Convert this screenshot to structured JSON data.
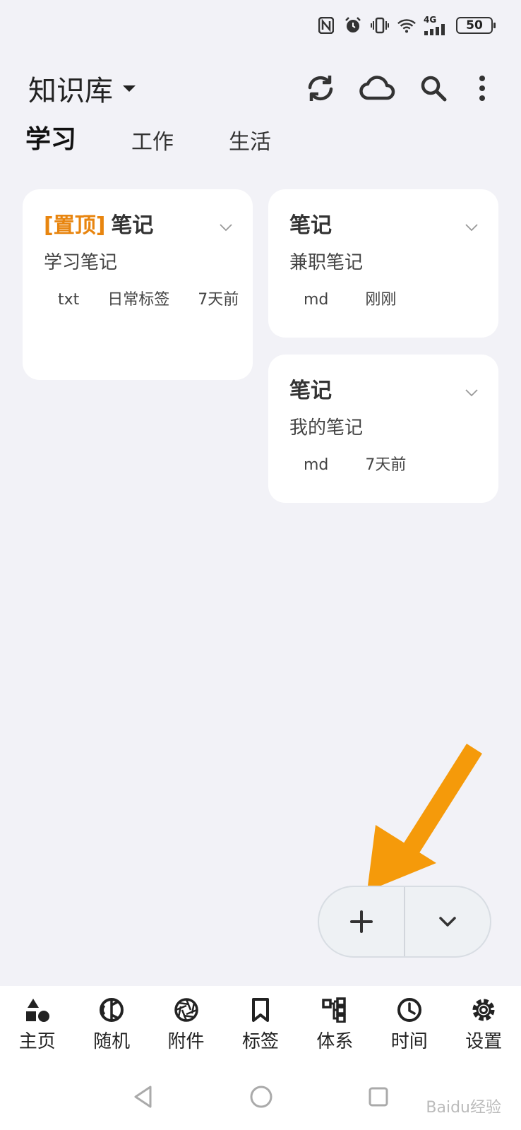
{
  "status": {
    "battery": "50",
    "network": "4G"
  },
  "header": {
    "title": "知识库"
  },
  "tabs": [
    {
      "label": "学习",
      "active": true
    },
    {
      "label": "工作",
      "active": false
    },
    {
      "label": "生活",
      "active": false
    }
  ],
  "cards": [
    {
      "pin": "[置顶]",
      "title": "笔记",
      "subtitle": "学习笔记",
      "meta": [
        "txt",
        "日常标签",
        "7天前"
      ]
    },
    {
      "pin": "",
      "title": "笔记",
      "subtitle": "兼职笔记",
      "meta": [
        "md",
        "刚刚"
      ]
    },
    {
      "pin": "",
      "title": "笔记",
      "subtitle": "我的笔记",
      "meta": [
        "md",
        "7天前"
      ]
    }
  ],
  "nav": [
    {
      "label": "主页",
      "icon": "home-shapes-icon"
    },
    {
      "label": "随机",
      "icon": "random-icon"
    },
    {
      "label": "附件",
      "icon": "aperture-icon"
    },
    {
      "label": "标签",
      "icon": "bookmark-icon"
    },
    {
      "label": "体系",
      "icon": "hierarchy-icon"
    },
    {
      "label": "时间",
      "icon": "clock-icon"
    },
    {
      "label": "设置",
      "icon": "gear-icon"
    }
  ],
  "colors": {
    "accent": "#e8850f",
    "arrow": "#f59a0a",
    "background": "#f2f2f7"
  },
  "watermark": "Baidu经验"
}
